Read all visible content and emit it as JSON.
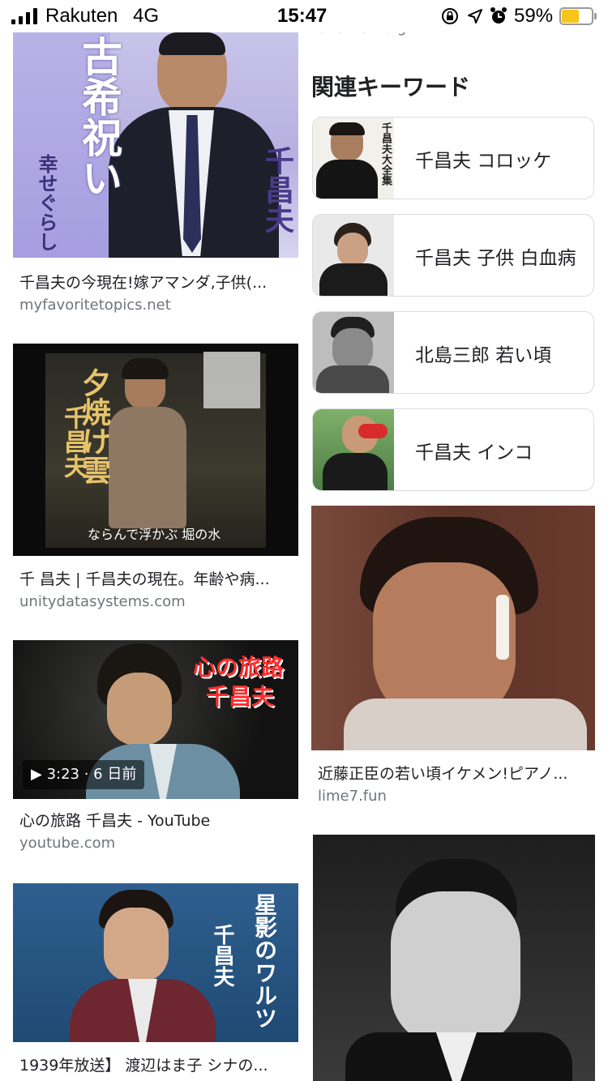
{
  "status_bar": {
    "carrier": "Rakuten",
    "network": "4G",
    "time": "15:47",
    "battery": "59%",
    "battery_level": 0.59,
    "icons": [
      "signal-bars-icon",
      "screen-lock-rotation-icon",
      "location-arrow-icon",
      "alarm-clock-icon",
      "battery-icon"
    ]
  },
  "partial_top_domain": "ohohfun.org",
  "left_results": [
    {
      "thumb_texts": [
        "古希祝い",
        "千昌夫",
        "幸せぐらし"
      ],
      "title": "千昌夫の今現在!嫁アマンダ,子供(...",
      "domain": "myfavoritetopics.net"
    },
    {
      "thumb_texts": [
        "夕焼け雲",
        "千昌夫",
        "ならんで浮かぶ 堀の水"
      ],
      "title": "千 昌夫 | 千昌夫の現在。年齢や病...",
      "domain": "unitydatasystems.com"
    },
    {
      "thumb_texts": [
        "心の旅路",
        "千昌夫"
      ],
      "duration": "3:23 · 6 日前",
      "title": "心の旅路 千昌夫 - YouTube",
      "domain": "youtube.com"
    },
    {
      "thumb_texts": [
        "星影のワルツ",
        "千昌夫"
      ],
      "title": "1939年放送】 渡辺はま子 シナの..."
    }
  ],
  "related": {
    "heading": "関連キーワード",
    "items": [
      {
        "label": "千昌夫 コロッケ",
        "thumb_text": "千昌夫大全集"
      },
      {
        "label": "千昌夫 子供 白血病"
      },
      {
        "label": "北島三郎 若い頃"
      },
      {
        "label": "千昌夫 インコ"
      }
    ]
  },
  "right_results": [
    {
      "title": "近藤正臣の若い頃イケメン!ピアノ...",
      "domain": "lime7.fun"
    },
    {}
  ],
  "colors": {
    "link_text": "#202124",
    "domain_text": "#70757a",
    "chip_border": "#dadce0",
    "battery_fill": "#f5c518"
  }
}
